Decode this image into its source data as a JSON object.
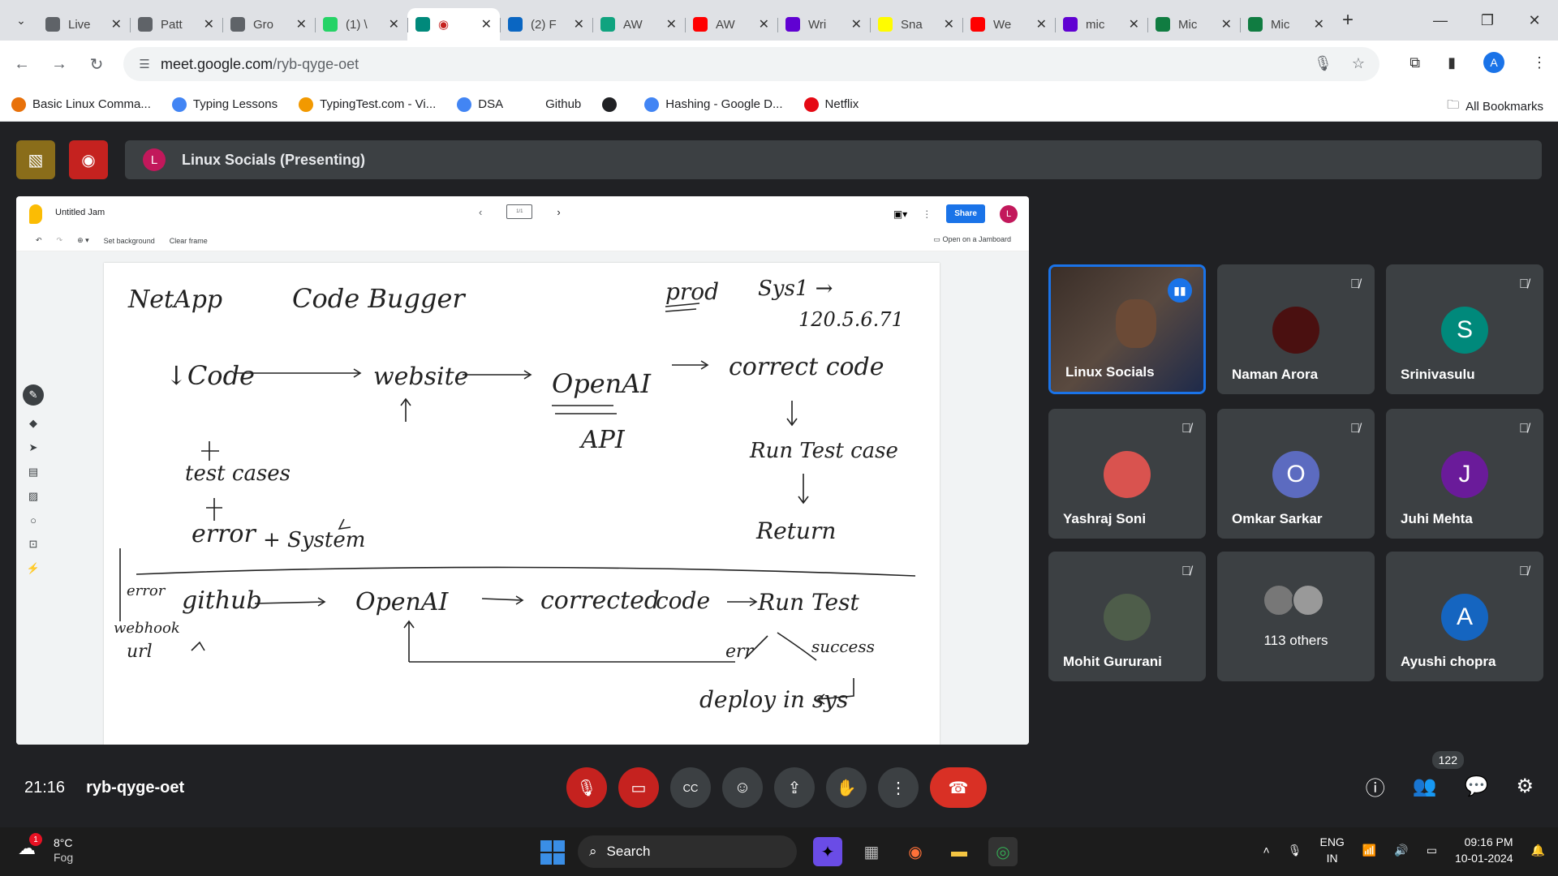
{
  "browser": {
    "tabs": [
      {
        "label": "Live",
        "color": "#5f6368"
      },
      {
        "label": "Patt",
        "color": "#5f6368"
      },
      {
        "label": "Gro",
        "color": "#5f6368"
      },
      {
        "label": "(1) \\",
        "color": "#25d366"
      },
      {
        "label": "",
        "color": "#00897b",
        "active": true
      },
      {
        "label": "(2) F",
        "color": "#0a66c2"
      },
      {
        "label": "AW",
        "color": "#10a37f"
      },
      {
        "label": "AW",
        "color": "#ff0000"
      },
      {
        "label": "Wri",
        "color": "#6001d2"
      },
      {
        "label": "Sna",
        "color": "#fffc00"
      },
      {
        "label": "We",
        "color": "#ff0000"
      },
      {
        "label": "mic",
        "color": "#6001d2"
      },
      {
        "label": "Mic",
        "color": "#107c41"
      },
      {
        "label": "Mic",
        "color": "#107c41"
      }
    ],
    "url_host": "meet.google.com",
    "url_path": "/ryb-qyge-oet",
    "profile_initial": "A",
    "bookmarks": [
      {
        "label": "Basic Linux Comma...",
        "color": "#e8710a"
      },
      {
        "label": "Typing Lessons",
        "color": "#4285f4"
      },
      {
        "label": "TypingTest.com - Vi...",
        "color": "#f29900"
      },
      {
        "label": "DSA",
        "color": "#4285f4"
      },
      {
        "label": "Github",
        "color": "#ffffff"
      },
      {
        "label": "",
        "color": "#202124"
      },
      {
        "label": "Hashing - Google D...",
        "color": "#4285f4"
      },
      {
        "label": "Netflix",
        "color": "#e50914"
      }
    ],
    "all_bookmarks": "All Bookmarks"
  },
  "meet": {
    "presenter_initial": "L",
    "presenter_label": "Linux Socials (Presenting)",
    "meeting_time": "21:16",
    "meeting_code": "ryb-qyge-oet",
    "people_count": "122",
    "participants": [
      {
        "name": "Linux Socials",
        "speaking": true
      },
      {
        "name": "Naman Arora",
        "initial": "",
        "color": "#4a1010"
      },
      {
        "name": "Srinivasulu",
        "initial": "S",
        "color": "#00897b"
      },
      {
        "name": "Yashraj Soni",
        "initial": "",
        "color": "#d9534f"
      },
      {
        "name": "Omkar Sarkar",
        "initial": "O",
        "color": "#5c6bc0"
      },
      {
        "name": "Juhi Mehta",
        "initial": "J",
        "color": "#6a1b9a"
      },
      {
        "name": "Mohit Gururani",
        "initial": "",
        "color": "#4e5d4a"
      },
      {
        "name": "113 others"
      },
      {
        "name": "Ayushi chopra",
        "initial": "A",
        "color": "#1565c0"
      }
    ]
  },
  "jam": {
    "title": "Untitled Jam",
    "frame_count": "1/1",
    "share": "Share",
    "avatar": "L",
    "set_background": "Set background",
    "clear_frame": "Clear frame",
    "open_on_jamboard": "Open on a Jamboard",
    "whiteboard": {
      "netapp": "NetApp",
      "code_bugger": "Code Bugger",
      "prod": "prod",
      "sys1": "Sys1 →",
      "ip": "120.5.6.71",
      "code": "↓Code",
      "website": "website",
      "openai": "OpenAI",
      "api": "API",
      "correct_code": "correct code",
      "run_test": "Run Test case",
      "test_cases": "test cases",
      "error": "error",
      "system": "+ System",
      "return": "Return",
      "github": "github",
      "error_small": "error",
      "webhook": "webhook",
      "url": "url",
      "openai2": "OpenAI",
      "corrected": "corrected",
      "code2": "code",
      "run_test2": "Run Test",
      "err": "err",
      "success": "success",
      "deploy": "deploy in sys"
    }
  },
  "taskbar": {
    "temp": "8°C",
    "weather": "Fog",
    "weather_badge": "1",
    "search": "Search",
    "lang1": "ENG",
    "lang2": "IN",
    "time": "09:16 PM",
    "date": "10-01-2024"
  }
}
